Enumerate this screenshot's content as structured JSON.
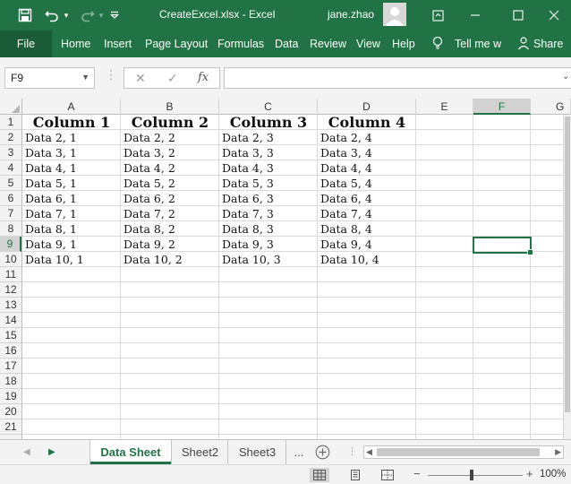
{
  "window": {
    "file_title": "CreateExcel.xlsx  -  Excel",
    "user_name": "jane.zhao"
  },
  "ribbon": {
    "tabs": [
      "File",
      "Home",
      "Insert",
      "Page Layout",
      "Formulas",
      "Data",
      "Review",
      "View",
      "Help"
    ],
    "tell_me": "Tell me w",
    "share": "Share"
  },
  "formula_bar": {
    "name_box": "F9",
    "fx_label": "fx",
    "formula_value": ""
  },
  "grid": {
    "columns": [
      "A",
      "B",
      "C",
      "D",
      "E",
      "F",
      "G"
    ],
    "selected_column": "F",
    "rows": [
      "1",
      "2",
      "3",
      "4",
      "5",
      "6",
      "7",
      "8",
      "9",
      "10",
      "11",
      "12",
      "13",
      "14",
      "15",
      "16",
      "17",
      "18",
      "19",
      "20",
      "21"
    ],
    "selected_row": "9",
    "header_row": [
      "Column 1",
      "Column 2",
      "Column 3",
      "Column 4"
    ],
    "data_rows": [
      [
        "Data 2, 1",
        "Data 2, 2",
        "Data 2, 3",
        "Data 2, 4"
      ],
      [
        "Data 3, 1",
        "Data 3, 2",
        "Data 3, 3",
        "Data 3, 4"
      ],
      [
        "Data 4, 1",
        "Data 4, 2",
        "Data 4, 3",
        "Data 4, 4"
      ],
      [
        "Data 5, 1",
        "Data 5, 2",
        "Data 5, 3",
        "Data 5, 4"
      ],
      [
        "Data 6, 1",
        "Data 6, 2",
        "Data 6, 3",
        "Data 6, 4"
      ],
      [
        "Data 7, 1",
        "Data 7, 2",
        "Data 7, 3",
        "Data 7, 4"
      ],
      [
        "Data 8, 1",
        "Data 8, 2",
        "Data 8, 3",
        "Data 8, 4"
      ],
      [
        "Data 9, 1",
        "Data 9, 2",
        "Data 9, 3",
        "Data 9, 4"
      ],
      [
        "Data 10, 1",
        "Data 10, 2",
        "Data 10, 3",
        "Data 10, 4"
      ]
    ]
  },
  "sheets": {
    "tabs": [
      "Data Sheet",
      "Sheet2",
      "Sheet3"
    ],
    "active": "Data Sheet",
    "more": "..."
  },
  "status": {
    "zoom": "100%"
  },
  "colors": {
    "accent": "#217346"
  }
}
